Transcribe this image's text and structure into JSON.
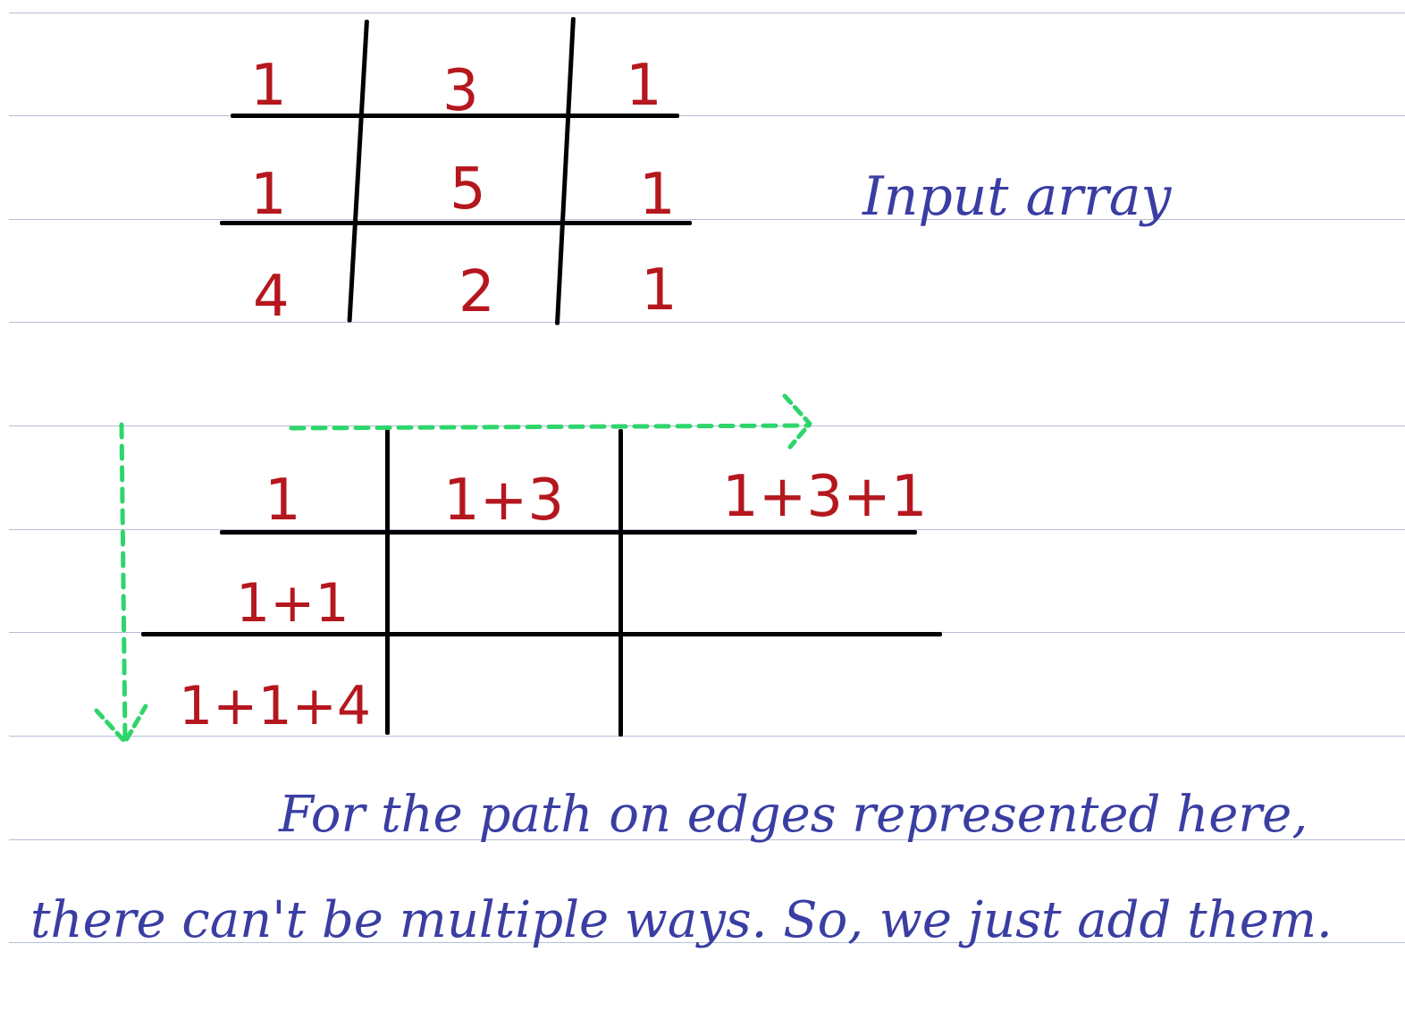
{
  "input_grid": {
    "rows": [
      [
        "1",
        "3",
        "1"
      ],
      [
        "1",
        "5",
        "1"
      ],
      [
        "4",
        "2",
        "1"
      ]
    ]
  },
  "input_label": "Input array",
  "dp_grid": {
    "first_row": [
      "1",
      "1+3",
      "1+3+1"
    ],
    "first_column": [
      "1",
      "1+1",
      "1+1+4"
    ]
  },
  "arrow_color": "#2ed56b",
  "ink_red": "#b5171e",
  "ink_blue": "#3a3ea3",
  "notes": {
    "line1": "For the path on edges represented here,",
    "line2": "there can't be multiple ways. So, we just add them."
  }
}
